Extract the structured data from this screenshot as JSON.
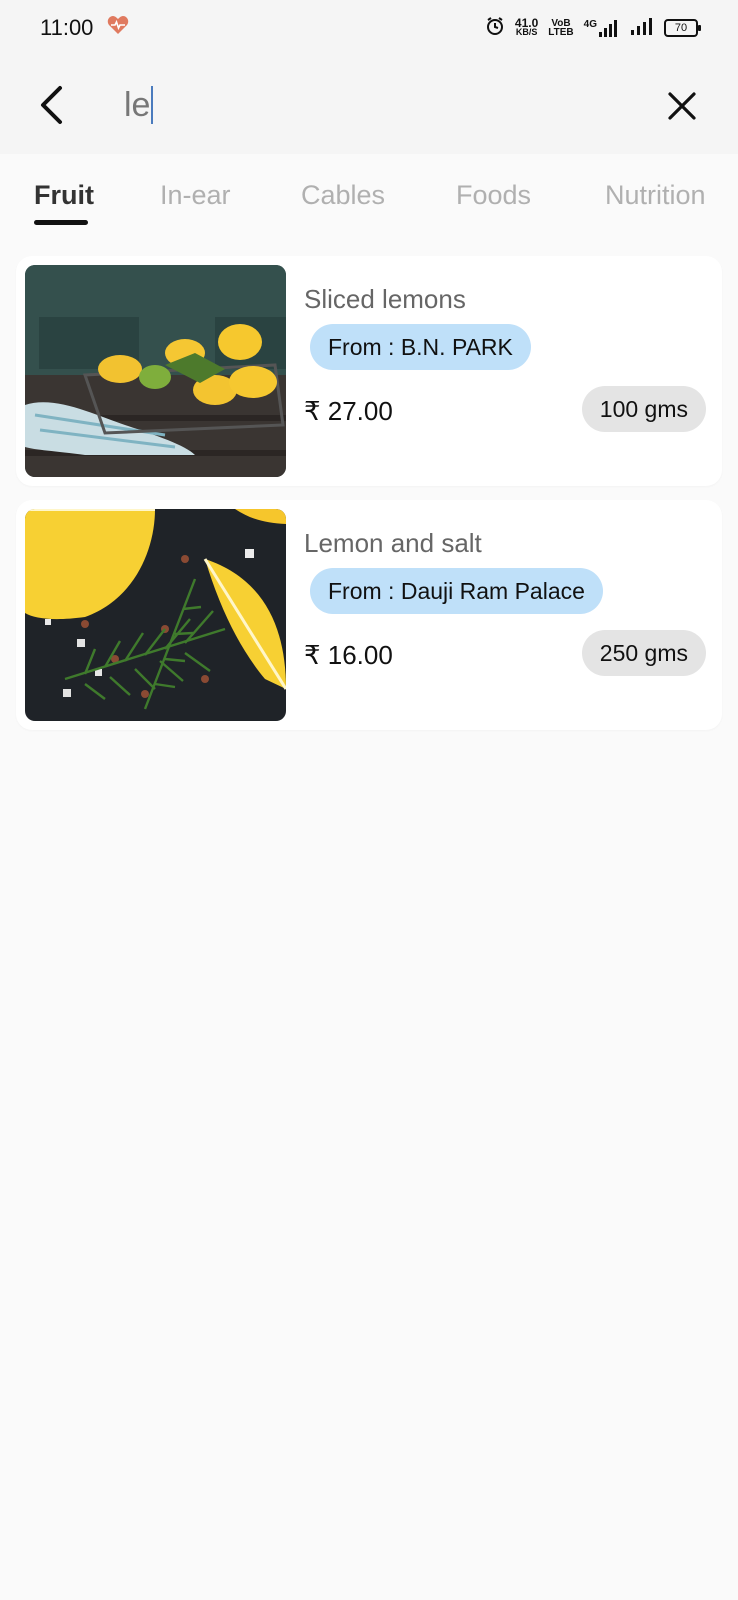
{
  "status_bar": {
    "time": "11:00",
    "net_speed_value": "41.0",
    "net_speed_unit": "KB/S",
    "volte_top": "VoB",
    "volte_bottom": "LTEB",
    "network_type": "4G",
    "battery_level": "70",
    "icons": [
      "heart-rate-icon",
      "alarm-icon",
      "signal-icon",
      "signal-icon-2",
      "battery-icon"
    ]
  },
  "search": {
    "query": "le"
  },
  "tabs": [
    {
      "label": "Fruit",
      "active": true
    },
    {
      "label": "In-ear",
      "active": false
    },
    {
      "label": "Cables",
      "active": false
    },
    {
      "label": "Foods",
      "active": false
    },
    {
      "label": "Nutrition",
      "active": false
    }
  ],
  "results": [
    {
      "title": "Sliced lemons",
      "from": "From : B.N. PARK",
      "price": "₹ 27.00",
      "quantity": "100 gms"
    },
    {
      "title": "Lemon and salt",
      "from": "From : Dauji Ram Palace",
      "price": "₹ 16.00",
      "quantity": "250 gms"
    }
  ],
  "colors": {
    "from_pill_bg": "#bfe0f9",
    "qty_pill_bg": "#e4e4e4",
    "active_tab": "#333333",
    "inactive_tab": "#b0b0b0",
    "heart_icon": "#e07a5f"
  }
}
